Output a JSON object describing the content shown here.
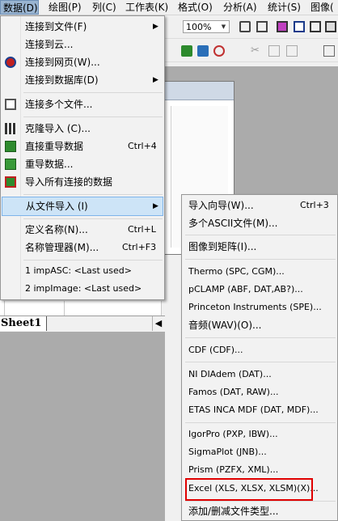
{
  "menubar": {
    "items": [
      {
        "label": "数据(D)"
      },
      {
        "label": "绘图(P)"
      },
      {
        "label": "列(C)"
      },
      {
        "label": "工作表(K)"
      },
      {
        "label": "格式(O)"
      },
      {
        "label": "分析(A)"
      },
      {
        "label": "统计(S)"
      },
      {
        "label": "图像("
      }
    ]
  },
  "toolbar": {
    "zoom_value": "100%"
  },
  "worksheet": {
    "sheet_tab": "Sheet1"
  },
  "main_menu": {
    "items": [
      {
        "label": "连接到文件(F)",
        "shortcut": "",
        "submenu": true
      },
      {
        "label": "连接到云...",
        "shortcut": "",
        "submenu": false
      },
      {
        "label": "连接到网页(W)...",
        "shortcut": "",
        "submenu": false
      },
      {
        "label": "连接到数据库(D)",
        "shortcut": "",
        "submenu": true
      },
      {
        "label": "连接多个文件...",
        "shortcut": "",
        "submenu": false
      },
      {
        "label": "克隆导入 (C)...",
        "shortcut": "",
        "submenu": false
      },
      {
        "label": "直接重导数据",
        "shortcut": "Ctrl+4",
        "submenu": false
      },
      {
        "label": "重导数据...",
        "shortcut": "",
        "submenu": false
      },
      {
        "label": "导入所有连接的数据",
        "shortcut": "",
        "submenu": false
      },
      {
        "label": "从文件导入 (I)",
        "shortcut": "",
        "submenu": true
      },
      {
        "label": "定义名称(N)...",
        "shortcut": "Ctrl+L",
        "submenu": false
      },
      {
        "label": "名称管理器(M)...",
        "shortcut": "Ctrl+F3",
        "submenu": false
      },
      {
        "label": "1 impASC: <Last used>",
        "shortcut": "",
        "submenu": false
      },
      {
        "label": "2 impImage: <Last used>",
        "shortcut": "",
        "submenu": false
      }
    ]
  },
  "import_submenu": {
    "items": [
      {
        "label": "导入向导(W)...",
        "shortcut": "Ctrl+3"
      },
      {
        "label": "多个ASCII文件(M)...",
        "shortcut": ""
      },
      {
        "label": "图像到矩阵(I)...",
        "shortcut": ""
      },
      {
        "label": "Thermo (SPC, CGM)...",
        "shortcut": ""
      },
      {
        "label": "pCLAMP (ABF, DAT,AB?)...",
        "shortcut": ""
      },
      {
        "label": "Princeton Instruments (SPE)...",
        "shortcut": ""
      },
      {
        "label": "音频(WAV)(O)...",
        "shortcut": ""
      },
      {
        "label": "CDF (CDF)...",
        "shortcut": ""
      },
      {
        "label": "NI DIAdem (DAT)...",
        "shortcut": ""
      },
      {
        "label": "Famos (DAT, RAW)...",
        "shortcut": ""
      },
      {
        "label": "ETAS INCA MDF (DAT, MDF)...",
        "shortcut": ""
      },
      {
        "label": "IgorPro (PXP, IBW)...",
        "shortcut": ""
      },
      {
        "label": "SigmaPlot (JNB)...",
        "shortcut": ""
      },
      {
        "label": "Prism (PZFX, XML)...",
        "shortcut": ""
      },
      {
        "label": "Excel (XLS, XLSX, XLSM)(X)...",
        "shortcut": ""
      },
      {
        "label": "添加/删减文件类型...",
        "shortcut": ""
      }
    ]
  },
  "colors": {
    "menu_highlight": "#cde4f7",
    "menubar_active": "#99b4d1",
    "annotation_box": "#e00000"
  }
}
